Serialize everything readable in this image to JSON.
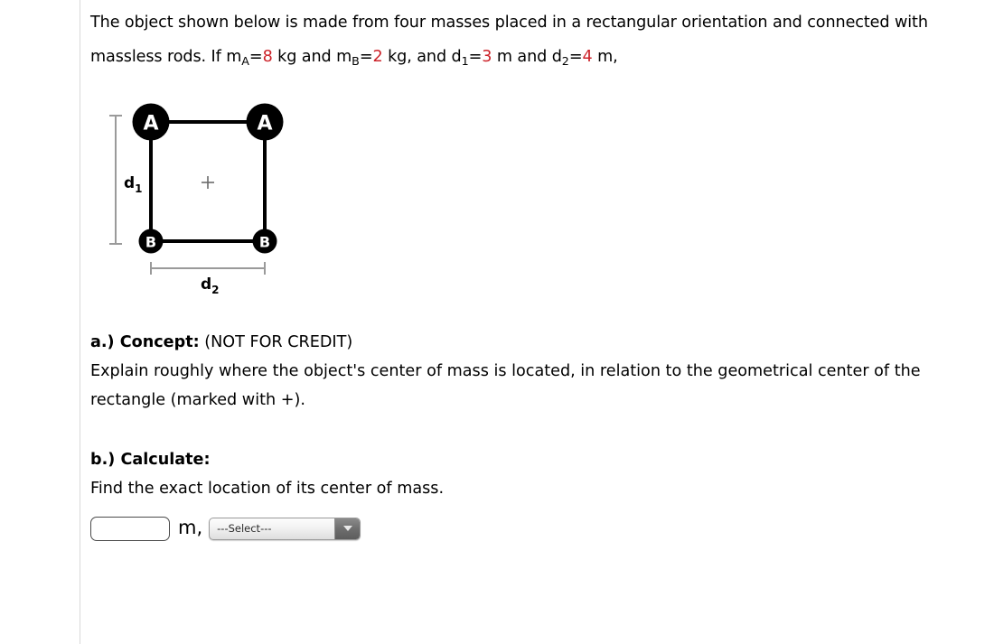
{
  "page": {
    "background": "#ffffff",
    "divider_color": "#d9d9d9",
    "accent_value_color": "#cc2229"
  },
  "problem": {
    "line1_pre": "The object shown below is made from four masses placed in a rectangular orientation and connected with massless rods. If m",
    "mass_a_sub": "A",
    "eq1": "=",
    "mass_a_value": "8",
    "unit_kg_1": " kg and m",
    "mass_b_sub": "B",
    "eq2": "=",
    "mass_b_value": "2",
    "unit_kg_2": " kg, and d",
    "d1_sub": "1",
    "eq3": "=",
    "d1_value": "3",
    "unit_m_1": " m and d",
    "d2_sub": "2",
    "eq4": "=",
    "d2_value": "4",
    "unit_m_2": " m,"
  },
  "figure": {
    "top_left_label": "A",
    "top_right_label": "A",
    "bottom_left_label": "B",
    "bottom_right_label": "B",
    "vertical_dimension_label": "d",
    "vertical_dimension_sub": "1",
    "horizontal_dimension_label": "d",
    "horizontal_dimension_sub": "2",
    "center_marker": "+",
    "mass_color": "#000000",
    "rod_color": "#000000",
    "dimension_line_color": "#9a9a9a",
    "center_marker_color": "#6b6b6b"
  },
  "part_a": {
    "heading": "a.) Concept:",
    "heading_note": "(NOT FOR CREDIT)",
    "body": "Explain roughly where the object's center of mass is located, in relation to the geometrical center of the rectangle (marked with +)."
  },
  "part_b": {
    "heading": "b.) Calculate:",
    "body": "Find the exact location of its center of mass."
  },
  "answer": {
    "input_value": "",
    "input_placeholder": "",
    "unit_label": "m,",
    "select_value": "---Select---",
    "select_options": [
      "---Select---"
    ]
  }
}
